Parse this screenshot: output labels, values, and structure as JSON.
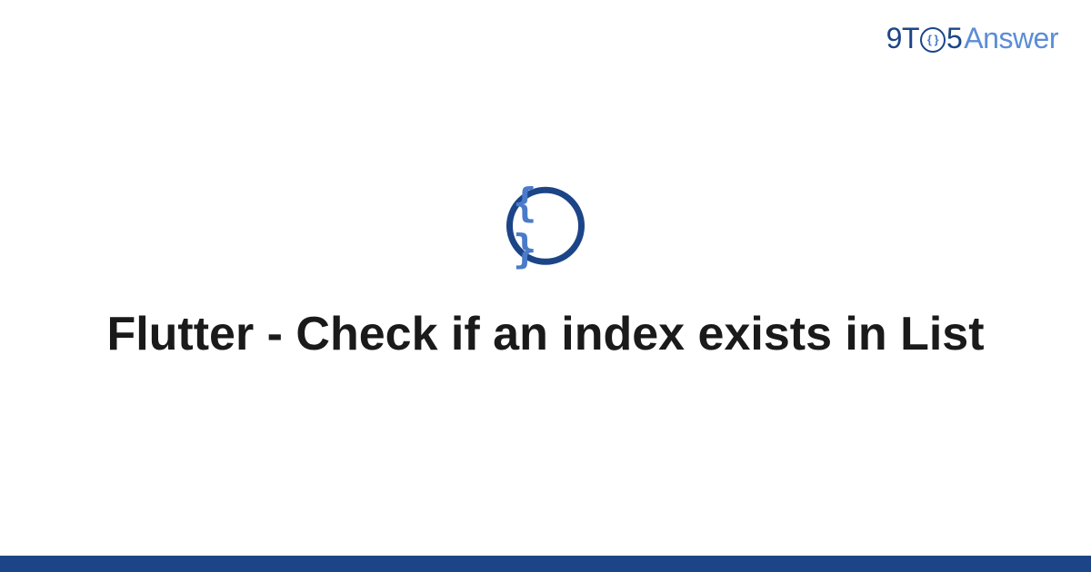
{
  "brand": {
    "prefix": "9T",
    "o_content": "{ }",
    "five": "5",
    "suffix": "Answer"
  },
  "icon": {
    "braces": "{ }"
  },
  "title": "Flutter - Check if an index exists in List"
}
